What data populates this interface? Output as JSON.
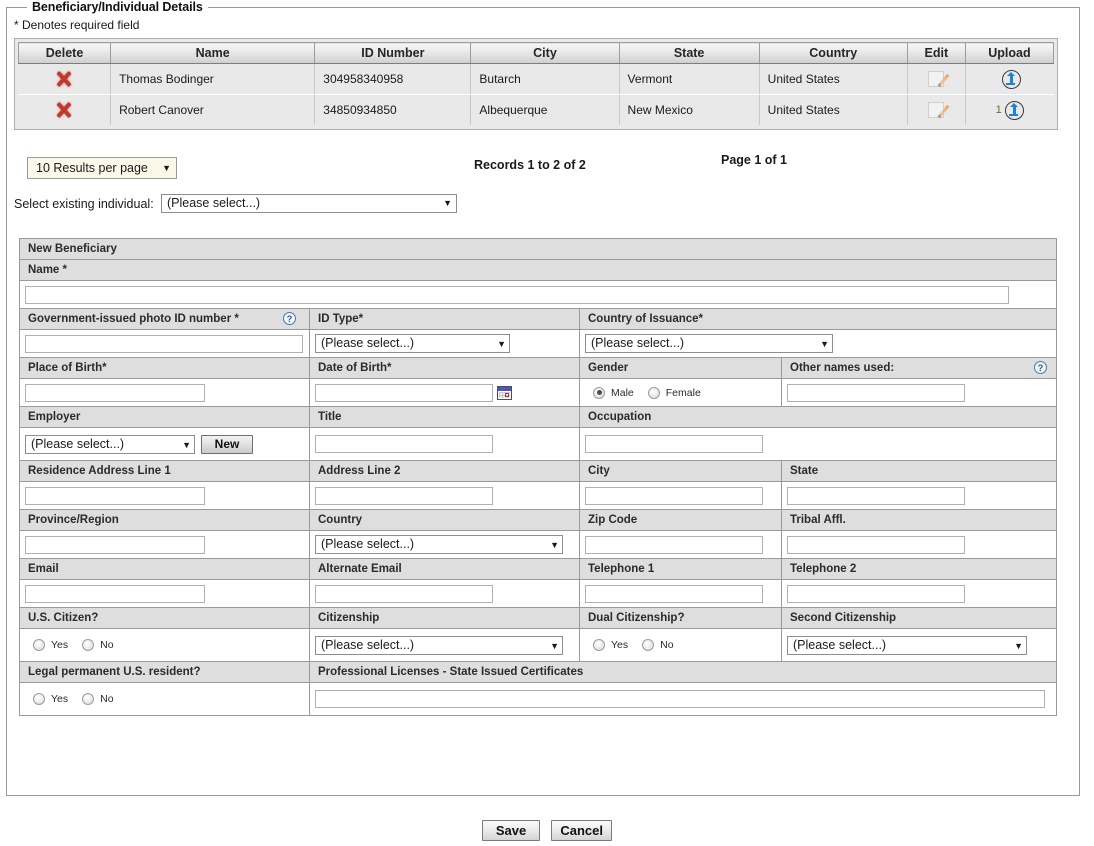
{
  "fieldset": {
    "legend": "Beneficiary/Individual Details",
    "required_note": "* Denotes required field"
  },
  "records_table": {
    "columns": [
      "Delete",
      "Name",
      "ID Number",
      "City",
      "State",
      "Country",
      "Edit",
      "Upload"
    ],
    "rows": [
      {
        "name": "Thomas Bodinger",
        "id_number": "304958340958",
        "city": "Butarch",
        "state": "Vermont",
        "country": "United States",
        "upload_count": ""
      },
      {
        "name": "Robert Canover",
        "id_number": "34850934850",
        "city": "Albequerque",
        "state": "New Mexico",
        "country": "United States",
        "upload_count": "1"
      }
    ]
  },
  "pager": {
    "results_per_page": "10 Results per page",
    "records_text": "Records 1 to 2 of 2",
    "page_text": "Page 1 of 1",
    "caret": "▼"
  },
  "select_existing": {
    "label": "Select existing individual:",
    "value": "(Please select...)",
    "caret": "▼"
  },
  "form": {
    "section_title": "New Beneficiary",
    "placeholder_select": "(Please select...)",
    "caret": "▼",
    "help_glyph": "?",
    "labels": {
      "name": "Name *",
      "gov_id": "Government-issued photo ID number *",
      "id_type": "ID Type*",
      "country_issuance": "Country of Issuance*",
      "place_of_birth": "Place of Birth*",
      "date_of_birth": "Date of Birth*",
      "gender": "Gender",
      "other_names": "Other names used:",
      "employer": "Employer",
      "title": "Title",
      "occupation": "Occupation",
      "res_addr1": "Residence Address Line 1",
      "addr2": "Address Line 2",
      "city": "City",
      "state": "State",
      "province": "Province/Region",
      "country": "Country",
      "zip": "Zip Code",
      "tribal": "Tribal Affl.",
      "email": "Email",
      "alt_email": "Alternate Email",
      "tel1": "Telephone 1",
      "tel2": "Telephone 2",
      "us_citizen": "U.S. Citizen?",
      "citizenship": "Citizenship",
      "dual_citizenship": "Dual Citizenship?",
      "second_citizenship": "Second Citizenship",
      "legal_resident": "Legal permanent U.S. resident?",
      "prof_licenses": "Professional Licenses - State Issued Certificates"
    },
    "values": {
      "name": "",
      "gov_id": "",
      "id_type": "(Please select...)",
      "country_issuance": "(Please select...)",
      "place_of_birth": "",
      "date_of_birth": "",
      "other_names": "",
      "employer": "(Please select...)",
      "title": "",
      "occupation": "",
      "res_addr1": "",
      "addr2": "",
      "city": "",
      "state": "",
      "province": "",
      "country": "(Please select...)",
      "zip": "",
      "tribal": "",
      "email": "",
      "alt_email": "",
      "tel1": "",
      "tel2": "",
      "citizenship": "(Please select...)",
      "second_citizenship": "(Please select...)",
      "prof_licenses": ""
    },
    "gender_options": {
      "male": "Male",
      "female": "Female"
    },
    "yes_no": {
      "yes": "Yes",
      "no": "No"
    },
    "new_button": "New"
  },
  "buttons": {
    "save": "Save",
    "cancel": "Cancel"
  },
  "colors": {
    "header_bg": "#dedede",
    "table_row_bg": "#e9e9e9",
    "delete_icon": "#c0392b",
    "upload_icon": "#1b84d6",
    "dropdown_cream": "#fbf8e9"
  }
}
